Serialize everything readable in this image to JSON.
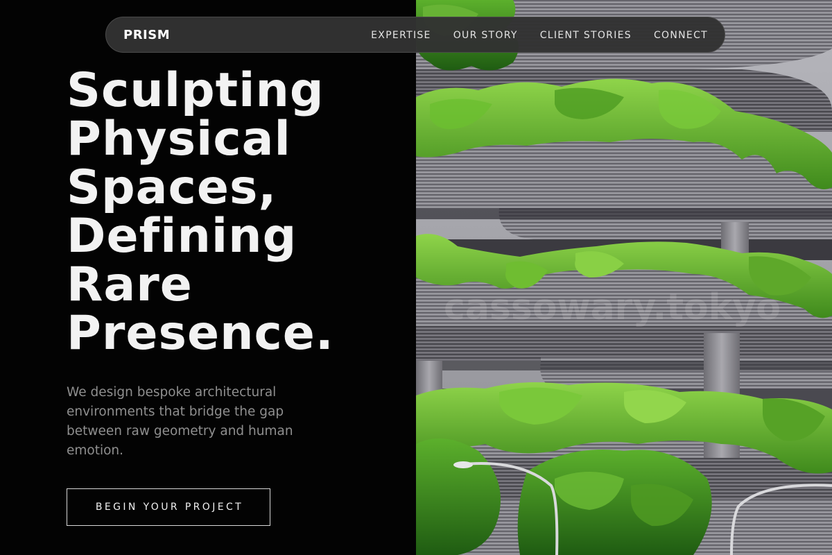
{
  "nav": {
    "brand": "PRISM",
    "links": [
      {
        "label": "EXPERTISE"
      },
      {
        "label": "OUR STORY"
      },
      {
        "label": "CLIENT STORIES"
      },
      {
        "label": "CONNECT"
      }
    ]
  },
  "hero": {
    "headline_lines": [
      "Sculpting",
      "Physical",
      "Spaces,",
      "Defining",
      "Rare",
      "Presence."
    ],
    "subtext": "We design bespoke architectural environments that bridge the gap between raw geometry and human emotion.",
    "cta_label": "BEGIN YOUR PROJECT",
    "image": {
      "subject": "curved grey layered building facade with green terrace plants",
      "watermark": "cassowary.tokyo"
    }
  },
  "colors": {
    "background": "#030303",
    "nav_background": "#323232",
    "headline": "#f2f2f2",
    "subtext": "#8f8f8f",
    "foliage": "#5aa82a",
    "concrete": "#8a8990"
  }
}
